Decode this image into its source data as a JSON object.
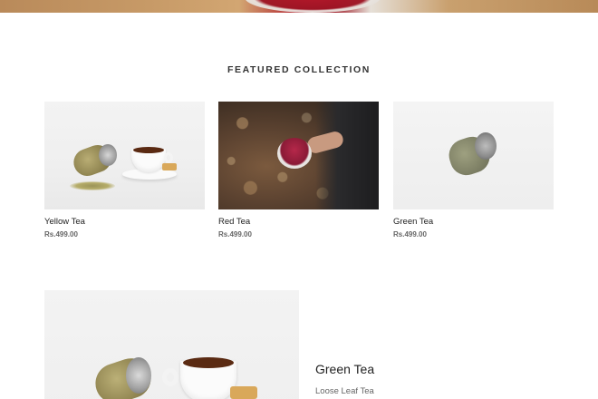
{
  "section": {
    "title": "FEATURED COLLECTION"
  },
  "products": [
    {
      "name": "Yellow Tea",
      "price": "Rs.499.00"
    },
    {
      "name": "Red Tea",
      "price": "Rs.499.00"
    },
    {
      "name": "Green Tea",
      "price": "Rs.499.00"
    }
  ],
  "featured": {
    "title": "Green Tea",
    "subtitle": "Loose Leaf Tea"
  },
  "colors": {
    "text": "#222222",
    "muted": "#666666",
    "background": "#ffffff"
  }
}
